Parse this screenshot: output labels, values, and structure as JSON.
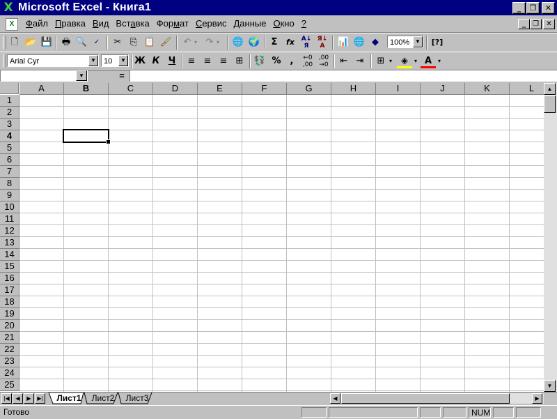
{
  "window": {
    "title": "Microsoft Excel - Книга1",
    "app_icon": "X",
    "caption_buttons": [
      "minimize-icon",
      "restore-icon",
      "close-icon"
    ]
  },
  "menu": {
    "items": [
      {
        "label": "Файл",
        "accel": "Ф",
        "rest": "айл"
      },
      {
        "label": "Правка",
        "accel": "П",
        "rest": "равка"
      },
      {
        "label": "Вид",
        "accel": "В",
        "rest": "ид"
      },
      {
        "label": "Вставка",
        "pre": "Вст",
        "accel": "а",
        "rest": "вка"
      },
      {
        "label": "Формат",
        "pre": "Фор",
        "accel": "м",
        "rest": "ат"
      },
      {
        "label": "Сервис",
        "accel": "С",
        "rest": "ервис"
      },
      {
        "label": "Данные",
        "accel": "Д",
        "rest": "анные"
      },
      {
        "label": "Окно",
        "accel": "О",
        "rest": "кно"
      },
      {
        "label": "?",
        "accel": "?",
        "rest": ""
      }
    ]
  },
  "toolbar_standard": {
    "zoom": "100%"
  },
  "toolbar_format": {
    "font_name": "Arial Cyr",
    "font_size": "10",
    "bold": "Ж",
    "italic": "К",
    "underline": "Ч",
    "percent": "%",
    "comma": ",",
    "sum": "Σ",
    "fx": "fx"
  },
  "formula_bar": {
    "name_box": "",
    "equals": "=",
    "content": ""
  },
  "sheet": {
    "columns": [
      "A",
      "B",
      "C",
      "D",
      "E",
      "F",
      "G",
      "H",
      "I",
      "J",
      "K",
      "L"
    ],
    "rows": [
      "1",
      "2",
      "3",
      "4",
      "5",
      "6",
      "7",
      "8",
      "9",
      "10",
      "11",
      "12",
      "13",
      "14",
      "15",
      "16",
      "17",
      "18",
      "19",
      "20",
      "21",
      "22",
      "23",
      "24",
      "25"
    ],
    "active_column": "B",
    "active_row": "4"
  },
  "sheet_tabs": {
    "tabs": [
      "Лист1",
      "Лист2",
      "Лист3"
    ],
    "active": "Лист1"
  },
  "status": {
    "text": "Готово",
    "num": "NUM"
  }
}
